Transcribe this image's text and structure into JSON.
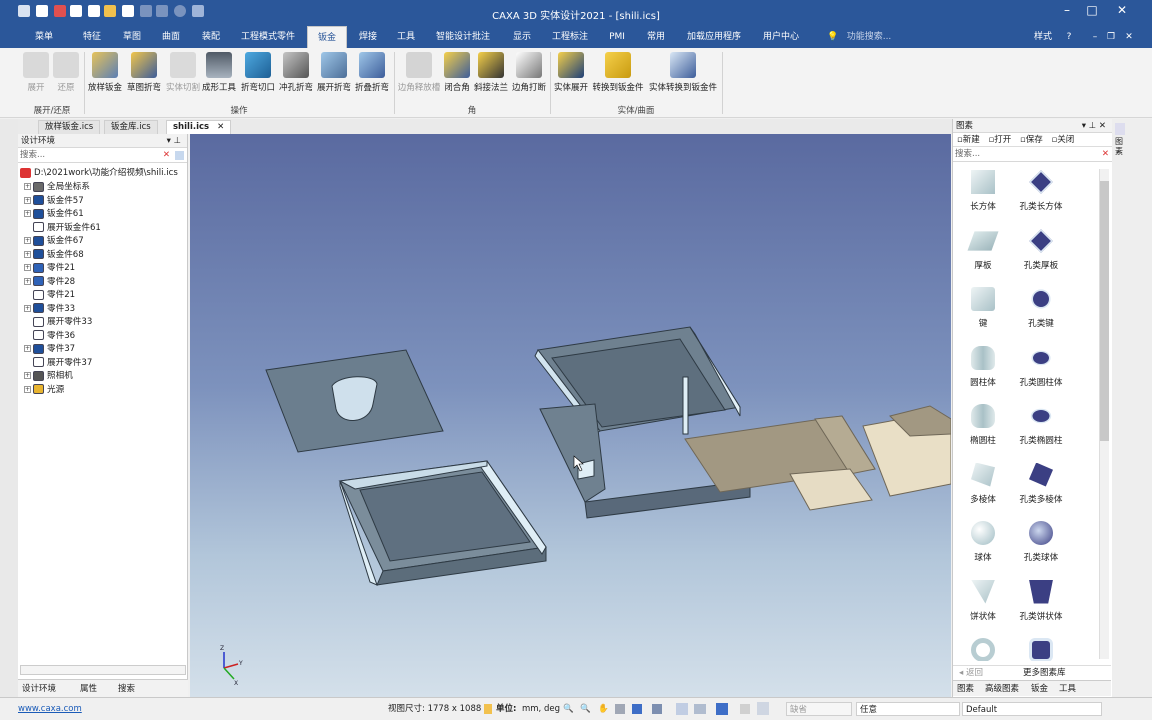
{
  "app": {
    "title": "CAXA 3D 实体设计2021 - [shili.ics]"
  },
  "window_controls": {
    "min": "–",
    "max": "□",
    "close": "✕",
    "restore": "❐"
  },
  "menu": {
    "tabs": [
      "菜单",
      "特征",
      "草图",
      "曲面",
      "装配",
      "工程模式零件",
      "钣金",
      "焊接",
      "工具",
      "智能设计批注",
      "显示",
      "工程标注",
      "PMI",
      "常用",
      "加载应用程序",
      "用户中心"
    ],
    "active": "钣金",
    "search_placeholder": "功能搜索...",
    "style_label": "样式",
    "help": "?"
  },
  "ribbon": {
    "groups": [
      {
        "name": "展开/还原"
      },
      {
        "name": "操作"
      },
      {
        "name": "角"
      },
      {
        "name": "实体/曲面"
      }
    ],
    "buttons": [
      "展开",
      "还原",
      "放样钣金",
      "草图折弯",
      "实体切割",
      "成形工具",
      "折弯切口",
      "冲孔折弯",
      "展开折弯",
      "折叠折弯",
      "边角释放槽",
      "闭合角",
      "斜接法兰",
      "边角打断",
      "实体展开",
      "转换到钣金件",
      "实体转换到钣金件"
    ]
  },
  "doc_tabs": [
    "放样钣金.ics",
    "钣金库.ics",
    "shili.ics"
  ],
  "design_env": {
    "header": "设计环境",
    "search_placeholder": "搜索...",
    "root": "D:\\2021work\\功能介绍视频\\shili.ics",
    "items": [
      "全局坐标系",
      "钣金件57",
      "钣金件61",
      "展开钣金件61",
      "钣金件67",
      "钣金件68",
      "零件21",
      "零件28",
      "零件21",
      "零件33",
      "展开零件33",
      "零件36",
      "零件37",
      "展开零件37",
      "照相机",
      "光源"
    ],
    "tabs": [
      "设计环境",
      "属性",
      "搜索"
    ]
  },
  "library": {
    "header": "图素",
    "toolbar": [
      "新建",
      "打开",
      "保存",
      "关闭"
    ],
    "search_placeholder": "搜索...",
    "items": [
      "长方体",
      "孔类长方体",
      "厚板",
      "孔类厚板",
      "键",
      "孔类键",
      "圆柱体",
      "孔类圆柱体",
      "椭圆柱",
      "孔类椭圆柱",
      "多棱体",
      "孔类多棱体",
      "球体",
      "孔类球体",
      "饼状体",
      "孔类饼状体"
    ],
    "back": "返回",
    "more": "更多图素库",
    "tabs": [
      "图素",
      "高级图素",
      "钣金",
      "工具"
    ]
  },
  "side_labels": [
    "图素"
  ],
  "status": {
    "link": "www.caxa.com",
    "view_size": "视图尺寸: 1778 x 1088",
    "unit_label": "单位:",
    "unit_value": "mm, deg",
    "snap": "缺省",
    "select": "任意",
    "style": "Default"
  },
  "axes": {
    "z": "Z",
    "x": "X",
    "y": "Y"
  },
  "colors": {
    "titlebar": "#2b579a",
    "part": "#6e808f",
    "part_edge": "#2e3a44",
    "highlight": "#cfe2ee",
    "tan": "#a59b84"
  }
}
